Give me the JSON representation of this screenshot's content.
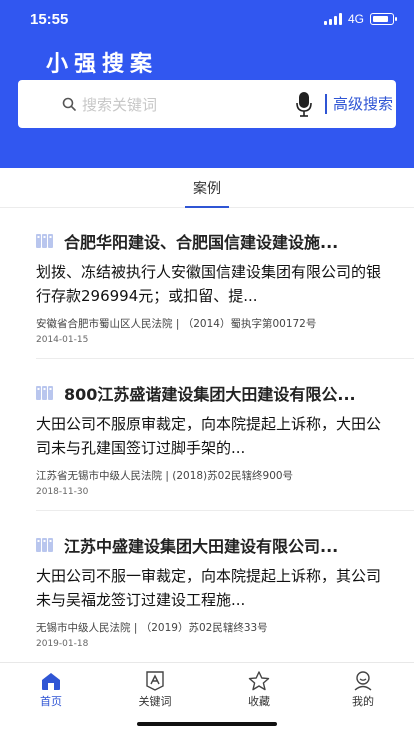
{
  "status_bar": {
    "time": "15:55",
    "network": "4G",
    "battery_level": 0.85
  },
  "app": {
    "title": "小强搜案"
  },
  "search": {
    "placeholder": "搜索关键词",
    "advanced_label": "高级搜索"
  },
  "tabs": [
    {
      "label": "案例",
      "active": true
    }
  ],
  "cases": [
    {
      "title": "合肥华阳建设、合肥国信建设建设施...",
      "summary": "划拨、冻结被执行人安徽国信建设集团有限公司的银行存款296994元；或扣留、提...",
      "court": "安徽省合肥市蜀山区人民法院",
      "case_no": "（2014）蜀执字第00172号",
      "date": "2014-01-15"
    },
    {
      "title": "800江苏盛谐建设集团大田建设有限公...",
      "summary": "大田公司不服原审裁定，向本院提起上诉称，大田公司未与孔建国签订过脚手架的...",
      "court": "江苏省无锡市中级人民法院",
      "case_no": "(2018)苏02民辖终900号",
      "date": "2018-11-30"
    },
    {
      "title": "江苏中盛建设集团大田建设有限公司...",
      "summary": "大田公司不服一审裁定，向本院提起上诉称，其公司未与吴福龙签订过建设工程施...",
      "court": "无锡市中级人民法院",
      "case_no": "（2019）苏02民辖终33号",
      "date": "2019-01-18"
    }
  ],
  "meta_separator": "|",
  "bottom_nav": [
    {
      "label": "首页",
      "icon": "home-icon",
      "active": true
    },
    {
      "label": "关键词",
      "icon": "keyword-icon",
      "active": false
    },
    {
      "label": "收藏",
      "icon": "star-icon",
      "active": false
    },
    {
      "label": "我的",
      "icon": "profile-icon",
      "active": false
    }
  ],
  "colors": {
    "brand": "#3157f0",
    "accent": "#2f55d4",
    "icon_light": "#b9c6ee"
  }
}
